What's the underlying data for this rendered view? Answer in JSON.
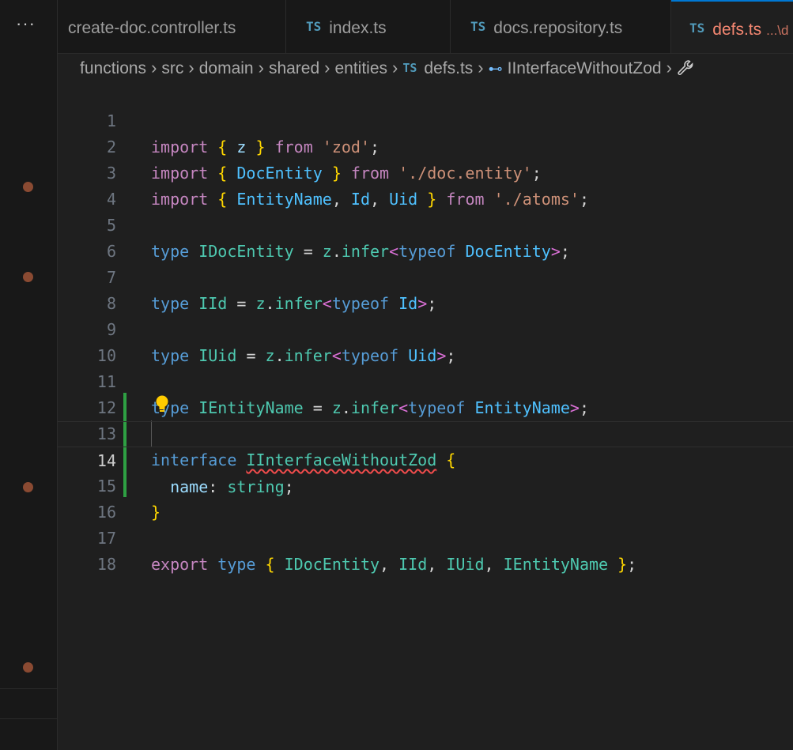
{
  "sidebar": {
    "more_label": "···"
  },
  "tabs": [
    {
      "label": "create-doc.controller.ts",
      "badge": ""
    },
    {
      "label": "index.ts",
      "badge": "TS"
    },
    {
      "label": "docs.repository.ts",
      "badge": "TS"
    },
    {
      "label": "defs.ts",
      "badge": "TS",
      "path": "...\\d"
    }
  ],
  "breadcrumb": {
    "parts": [
      "functions",
      "src",
      "domain",
      "shared",
      "entities"
    ],
    "file_badge": "TS",
    "file": "defs.ts",
    "symbol": "IInterfaceWithoutZod"
  },
  "editor": {
    "current_line": 14,
    "line_numbers": [
      "1",
      "2",
      "3",
      "4",
      "5",
      "6",
      "7",
      "8",
      "9",
      "10",
      "11",
      "12",
      "13",
      "14",
      "15",
      "16",
      "17",
      "18"
    ],
    "tokens": {
      "import": "import",
      "from": "from",
      "type": "type",
      "typeof": "typeof",
      "interface": "interface",
      "export": "export",
      "z": "z",
      "infer": "infer",
      "DocEntity": "DocEntity",
      "EntityName": "EntityName",
      "Id": "Id",
      "Uid": "Uid",
      "str_zod": "'zod'",
      "str_doc_entity": "'./doc.entity'",
      "str_atoms": "'./atoms'",
      "IDocEntity": "IDocEntity",
      "IId": "IId",
      "IUid": "IUid",
      "IEntityName": "IEntityName",
      "IInterfaceWithoutZod": "IInterfaceWithoutZod",
      "name": "name",
      "string": "string"
    }
  },
  "colors": {
    "accent": "#0078d4",
    "keyword": "#569cd6",
    "control_keyword": "#c586c0",
    "type": "#4ec9b0",
    "string": "#ce9178",
    "bracket": "#ffd700",
    "git_added": "#2ea043",
    "error": "#f14c4c",
    "modified_tab": "#f48771"
  },
  "icons": [
    "ellipsis-icon",
    "typescript-icon",
    "symbol-interface-icon",
    "chevron-right-icon",
    "lightbulb-icon",
    "wrench-icon"
  ]
}
